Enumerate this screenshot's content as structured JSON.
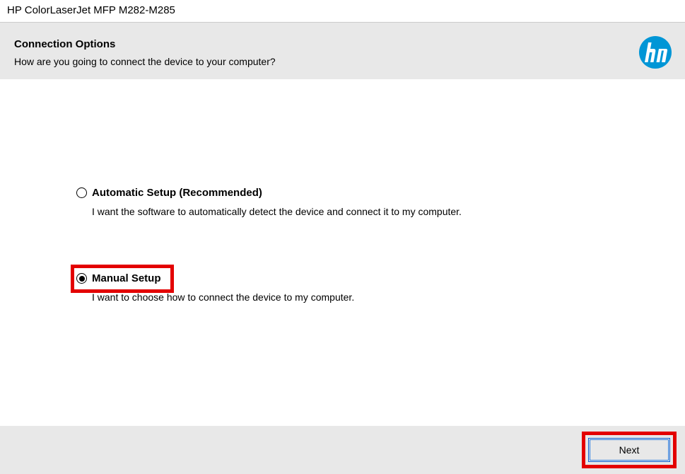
{
  "window": {
    "title": "HP ColorLaserJet MFP M282-M285"
  },
  "header": {
    "title": "Connection Options",
    "subtitle": "How are you going to connect the device to your computer?"
  },
  "options": {
    "auto": {
      "label": "Automatic Setup (Recommended)",
      "desc": "I want the software to automatically detect the device and connect it to my computer.",
      "selected": false
    },
    "manual": {
      "label": "Manual Setup",
      "desc": "I want to choose how to connect the device to my computer.",
      "selected": true
    }
  },
  "buttons": {
    "next": "Next"
  },
  "brand": {
    "logo_color": "#0096d6"
  }
}
